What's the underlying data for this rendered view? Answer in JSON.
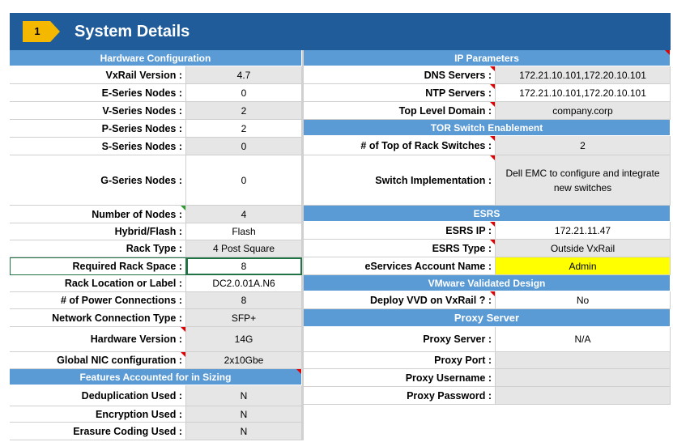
{
  "header": {
    "badge": "1",
    "title": "System Details"
  },
  "hardware": {
    "section_title": "Hardware Configuration",
    "rows": [
      {
        "label": "VxRail Version :",
        "value": "4.7"
      },
      {
        "label": "E-Series Nodes :",
        "value": "0"
      },
      {
        "label": "V-Series Nodes :",
        "value": "2"
      },
      {
        "label": "P-Series Nodes :",
        "value": "2"
      },
      {
        "label": "S-Series Nodes :",
        "value": "0"
      },
      {
        "label": "G-Series Nodes :",
        "value": "0"
      },
      {
        "label": "Number of Nodes :",
        "value": "4"
      },
      {
        "label": "Hybrid/Flash :",
        "value": "Flash"
      },
      {
        "label": "Rack Type :",
        "value": "4 Post Square"
      },
      {
        "label": "Required Rack Space :",
        "value": "8"
      },
      {
        "label": "Rack Location or Label :",
        "value": "DC2.0.01A.N6"
      },
      {
        "label": "# of Power Connections :",
        "value": "8"
      },
      {
        "label": "Network Connection Type :",
        "value": "SFP+"
      },
      {
        "label": "Hardware Version :",
        "value": "14G"
      },
      {
        "label": "Global NIC configuration :",
        "value": "2x10Gbe"
      }
    ]
  },
  "features": {
    "section_title": "Features Accounted for in Sizing",
    "rows": [
      {
        "label": "Deduplication Used :",
        "value": "N"
      },
      {
        "label": "Encryption Used :",
        "value": "N"
      },
      {
        "label": "Erasure Coding Used :",
        "value": "N"
      }
    ]
  },
  "ip": {
    "section_title": "IP Parameters",
    "rows": [
      {
        "label": "DNS Servers :",
        "value": "172.21.10.101,172.20.10.101"
      },
      {
        "label": "NTP Servers :",
        "value": "172.21.10.101,172.20.10.101"
      },
      {
        "label": "Top Level Domain :",
        "value": "company.corp"
      }
    ]
  },
  "tor": {
    "section_title": "TOR Switch Enablement",
    "rows": [
      {
        "label": "# of Top of Rack Switches :",
        "value": "2"
      },
      {
        "label": "Switch Implementation :",
        "value": "Dell EMC to configure and integrate new switches"
      }
    ]
  },
  "esrs": {
    "section_title": "ESRS",
    "rows": [
      {
        "label": "ESRS IP :",
        "value": "172.21.11.47"
      },
      {
        "label": "ESRS Type :",
        "value": "Outside VxRail"
      },
      {
        "label": "eServices Account Name :",
        "value": "Admin"
      }
    ]
  },
  "vvd": {
    "section_title": "VMware Validated Design",
    "rows": [
      {
        "label": "Deploy VVD on VxRail ? :",
        "value": "No"
      }
    ]
  },
  "proxy": {
    "section_title": "Proxy Server",
    "rows": [
      {
        "label": "Proxy Server :",
        "value": "N/A"
      },
      {
        "label": "Proxy Port :",
        "value": ""
      },
      {
        "label": "Proxy Username :",
        "value": ""
      },
      {
        "label": "Proxy Password :",
        "value": ""
      }
    ]
  },
  "colors": {
    "title_bar": "#1f5c99",
    "section_header": "#5b9bd5",
    "badge": "#f5b800",
    "highlight": "#ffff00",
    "comment_flag": "#e00000"
  }
}
